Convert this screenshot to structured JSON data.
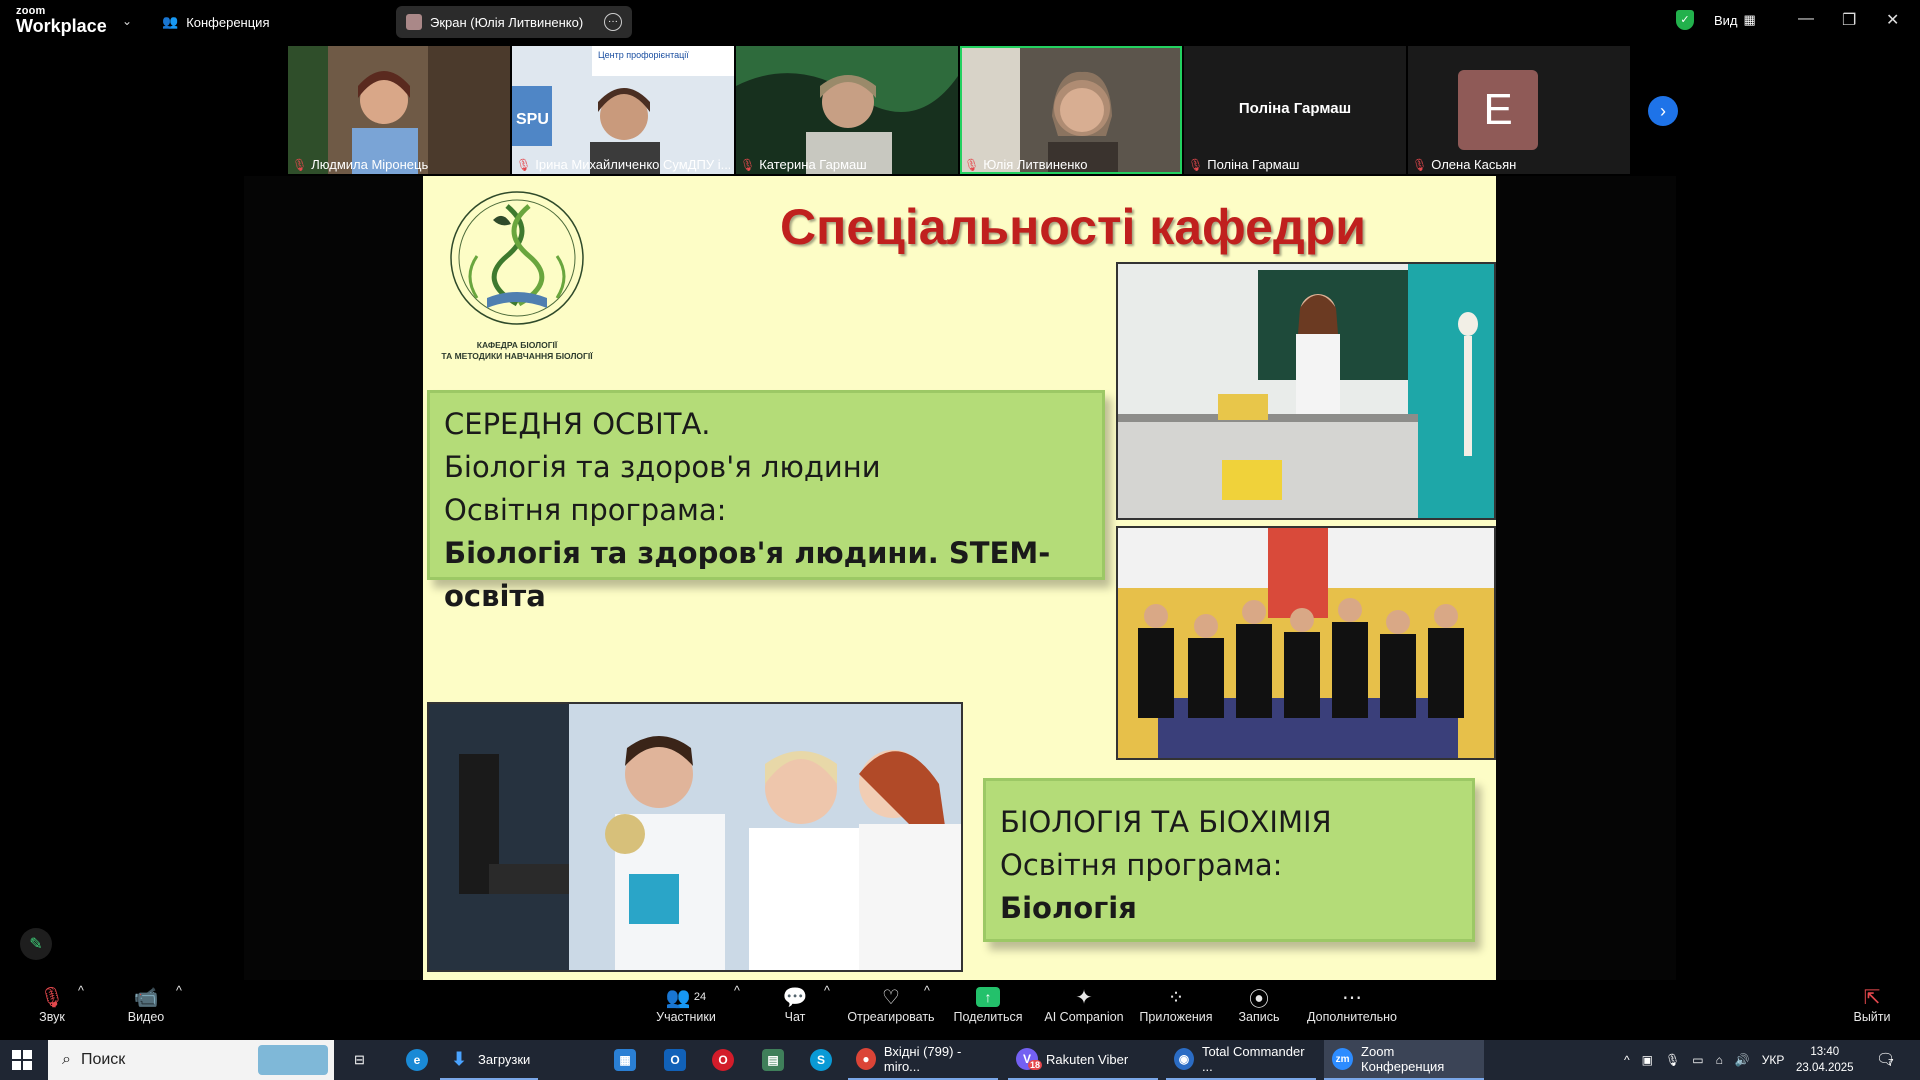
{
  "app": {
    "logo_line1": "zoom",
    "logo_line2": "Workplace",
    "meeting_label": "Конференция",
    "share_label": "Экран (Юлія Литвиненко)",
    "view_label": "Вид"
  },
  "participants": [
    {
      "name": "Людмила Міронець",
      "muted": true,
      "bg": "#6f5a46"
    },
    {
      "name": "Ірина Михайличенко СумДПУ і...",
      "muted": true,
      "bg": "#c9d7e6"
    },
    {
      "name": "Катерина Гармаш",
      "muted": true,
      "bg": "#2f4a34"
    },
    {
      "name": "Юлія Литвиненко",
      "muted": true,
      "bg": "#6f6457",
      "active": true
    },
    {
      "name": "Поліна Гармаш",
      "muted": true,
      "center_name": "Поліна Гармаш"
    },
    {
      "name": "Олена Касьян",
      "muted": true,
      "avatar_letter": "Е"
    }
  ],
  "slide": {
    "title": "Спеціальності кафедри",
    "emblem_caption_1": "КАФЕДРА БІОЛОГІЇ",
    "emblem_caption_2": "ТА МЕТОДИКИ НАВЧАННЯ БІОЛОГІЇ",
    "box1": {
      "line1": "СЕРЕДНЯ ОСВІТА.",
      "line2": "Біологія та здоров'я людини",
      "line3": "Освітня програма:",
      "line4": "Біологія та здоров'я людини. STEM-освіта"
    },
    "box2": {
      "line1": "БІОЛОГІЯ ТА БІОХІМІЯ",
      "line2": "Освітня програма:",
      "line3": "Біологія"
    }
  },
  "toolbar": {
    "audio": "Звук",
    "video": "Видео",
    "participants": "Участники",
    "participants_count": "24",
    "chat": "Чат",
    "react": "Отреагировать",
    "share": "Поделиться",
    "ai": "AI Companion",
    "apps": "Приложения",
    "record": "Запись",
    "more": "Дополнительно",
    "leave": "Выйти"
  },
  "taskbar": {
    "search_placeholder": "Поиск",
    "downloads": "Загрузки",
    "chrome": "Вхідні (799) - miro...",
    "viber": "Rakuten Viber",
    "viber_badge": "18",
    "totalcmd": "Total Commander ...",
    "zoom": "Zoom Конференция",
    "lang": "УКР",
    "time": "13:40",
    "date": "23.04.2025",
    "notifications": "7"
  },
  "colors": {
    "accent": "#1e73e8",
    "slide_bg": "#fdfdc6",
    "title_red": "#c0201e",
    "box_green": "#b4dc78",
    "active_green": "#23d160"
  }
}
